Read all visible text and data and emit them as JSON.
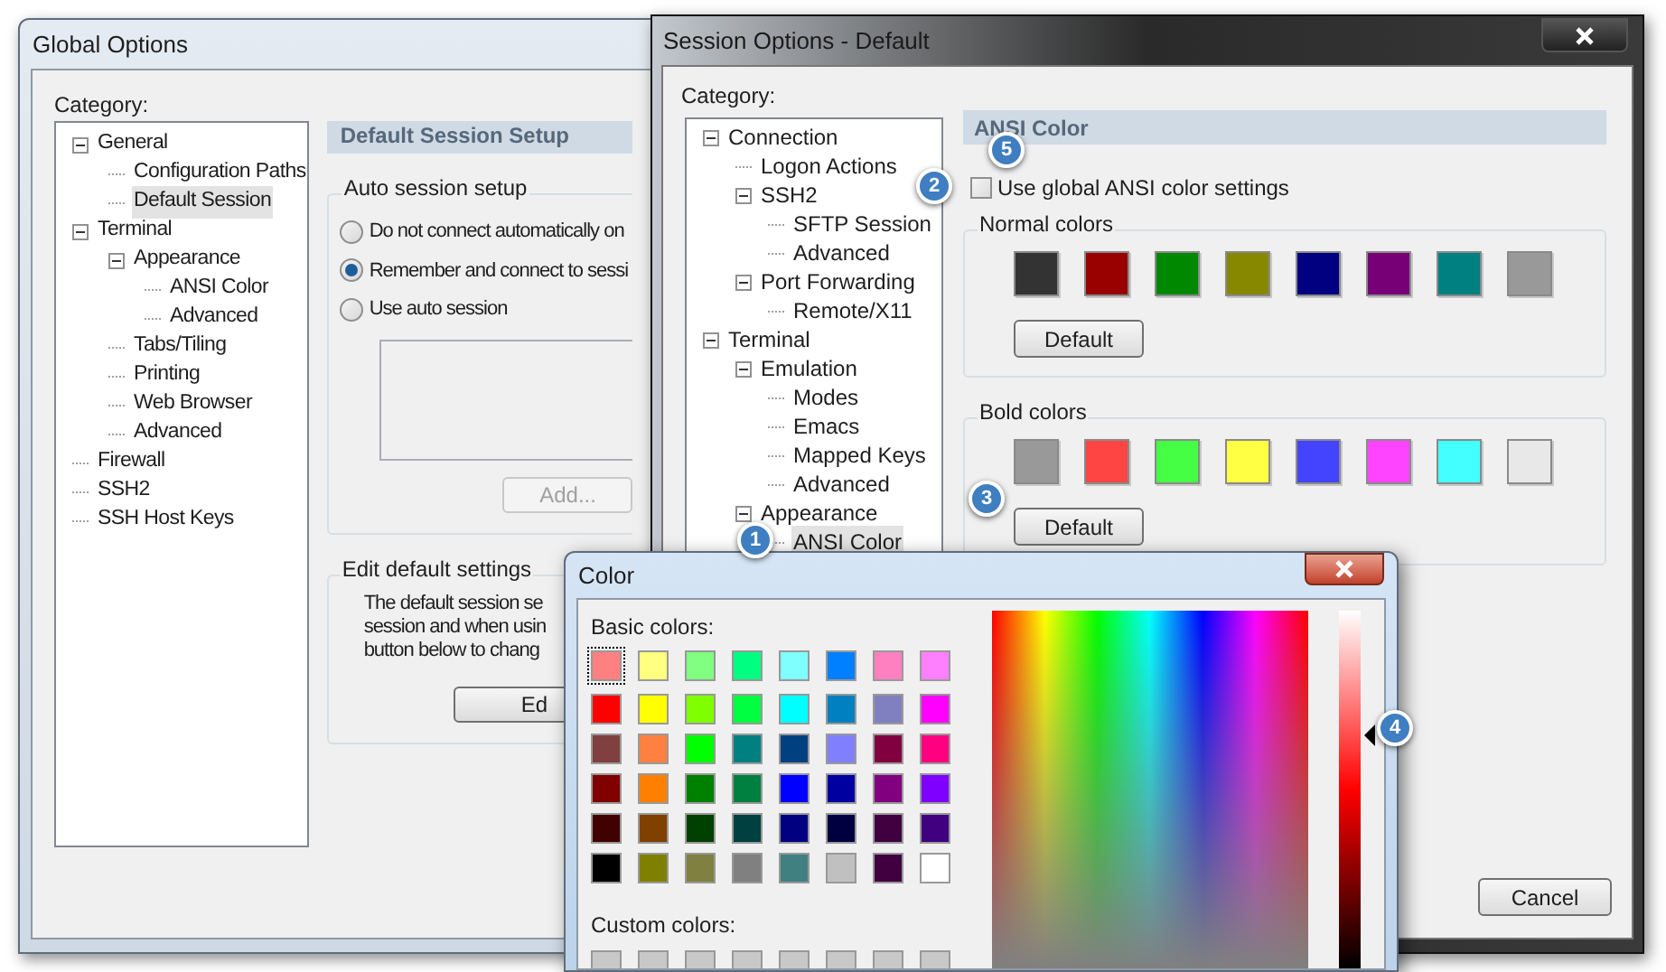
{
  "global_options": {
    "title": "Global Options",
    "category_label": "Category:",
    "tree": [
      {
        "label": "General",
        "expanded": true,
        "selected": false,
        "children": [
          {
            "label": "Configuration Paths",
            "selected": false
          },
          {
            "label": "Default Session",
            "selected": true
          }
        ]
      },
      {
        "label": "Terminal",
        "expanded": true,
        "selected": false,
        "children": [
          {
            "label": "Appearance",
            "expanded": true,
            "selected": false,
            "children": [
              {
                "label": "ANSI Color",
                "selected": false
              },
              {
                "label": "Advanced",
                "selected": false
              }
            ]
          },
          {
            "label": "Tabs/Tiling",
            "selected": false
          },
          {
            "label": "Printing",
            "selected": false
          },
          {
            "label": "Web Browser",
            "selected": false
          },
          {
            "label": "Advanced",
            "selected": false
          }
        ]
      },
      {
        "label": "Firewall",
        "selected": false
      },
      {
        "label": "SSH2",
        "selected": false
      },
      {
        "label": "SSH Host Keys",
        "selected": false
      }
    ],
    "panel_title": "Default Session Setup",
    "auto_session": {
      "label": "Auto session setup",
      "options": [
        {
          "label": "Do not connect automatically on",
          "selected": false
        },
        {
          "label": "Remember and connect to sessi",
          "selected": true
        },
        {
          "label": "Use auto session",
          "selected": false
        }
      ],
      "add_button": {
        "label": "Add...",
        "disabled": true
      }
    },
    "edit_defaults": {
      "label": "Edit default settings",
      "lines": [
        "The default session se",
        "session and when usin",
        "button below to chang"
      ],
      "button": "Ed"
    }
  },
  "session_options": {
    "title": "Session Options - Default",
    "category_label": "Category:",
    "tree": [
      {
        "label": "Connection",
        "expanded": true,
        "selected": false,
        "children": [
          {
            "label": "Logon Actions",
            "selected": false
          },
          {
            "label": "SSH2",
            "expanded": true,
            "selected": false,
            "children": [
              {
                "label": "SFTP Session",
                "selected": false
              },
              {
                "label": "Advanced",
                "selected": false
              }
            ]
          },
          {
            "label": "Port Forwarding",
            "expanded": true,
            "selected": false,
            "children": [
              {
                "label": "Remote/X11",
                "selected": false
              }
            ]
          }
        ]
      },
      {
        "label": "Terminal",
        "expanded": true,
        "selected": false,
        "children": [
          {
            "label": "Emulation",
            "expanded": true,
            "selected": false,
            "children": [
              {
                "label": "Modes",
                "selected": false
              },
              {
                "label": "Emacs",
                "selected": false
              },
              {
                "label": "Mapped Keys",
                "selected": false
              },
              {
                "label": "Advanced",
                "selected": false
              }
            ]
          },
          {
            "label": "Appearance",
            "expanded": true,
            "selected": false,
            "children": [
              {
                "label": "ANSI Color",
                "selected": true
              }
            ]
          }
        ]
      }
    ],
    "panel_title": "ANSI Color",
    "use_global": {
      "label": "Use global ANSI color settings",
      "checked": false
    },
    "normal_colors": {
      "label": "Normal colors",
      "swatches": [
        {
          "color": "#333333"
        },
        {
          "color": "#990000"
        },
        {
          "color": "#008800"
        },
        {
          "color": "#888800"
        },
        {
          "color": "#000080"
        },
        {
          "color": "#770077"
        },
        {
          "color": "#008080"
        },
        {
          "color": "#999999"
        }
      ],
      "button": "Default"
    },
    "bold_colors": {
      "label": "Bold colors",
      "swatches": [
        {
          "color": "#999999"
        },
        {
          "color": "#ff4444"
        },
        {
          "color": "#44ff44"
        },
        {
          "color": "#ffff44"
        },
        {
          "color": "#4444ff"
        },
        {
          "color": "#ff44ff"
        },
        {
          "color": "#44ffff"
        },
        {
          "color": "#e8e8e8"
        }
      ],
      "button": "Default"
    },
    "cancel_button": "Cancel"
  },
  "color_dialog": {
    "title": "Color",
    "basic_label": "Basic colors:",
    "basic_colors": [
      {
        "color": "#ff8080",
        "selected": true
      },
      {
        "color": "#ffff80",
        "selected": false
      },
      {
        "color": "#80ff80",
        "selected": false
      },
      {
        "color": "#00ff80",
        "selected": false
      },
      {
        "color": "#80ffff",
        "selected": false
      },
      {
        "color": "#0080ff",
        "selected": false
      },
      {
        "color": "#ff80c0",
        "selected": false
      },
      {
        "color": "#ff80ff",
        "selected": false
      },
      {
        "color": "#ff0000",
        "selected": false
      },
      {
        "color": "#ffff00",
        "selected": false
      },
      {
        "color": "#80ff00",
        "selected": false
      },
      {
        "color": "#00ff40",
        "selected": false
      },
      {
        "color": "#00ffff",
        "selected": false
      },
      {
        "color": "#0080c0",
        "selected": false
      },
      {
        "color": "#8080c0",
        "selected": false
      },
      {
        "color": "#ff00ff",
        "selected": false
      },
      {
        "color": "#804040",
        "selected": false
      },
      {
        "color": "#ff8040",
        "selected": false
      },
      {
        "color": "#00ff00",
        "selected": false
      },
      {
        "color": "#008080",
        "selected": false
      },
      {
        "color": "#004080",
        "selected": false
      },
      {
        "color": "#8080ff",
        "selected": false
      },
      {
        "color": "#800040",
        "selected": false
      },
      {
        "color": "#ff0080",
        "selected": false
      },
      {
        "color": "#800000",
        "selected": false
      },
      {
        "color": "#ff8000",
        "selected": false
      },
      {
        "color": "#008000",
        "selected": false
      },
      {
        "color": "#008040",
        "selected": false
      },
      {
        "color": "#0000ff",
        "selected": false
      },
      {
        "color": "#0000a0",
        "selected": false
      },
      {
        "color": "#800080",
        "selected": false
      },
      {
        "color": "#8000ff",
        "selected": false
      },
      {
        "color": "#400000",
        "selected": false
      },
      {
        "color": "#804000",
        "selected": false
      },
      {
        "color": "#004000",
        "selected": false
      },
      {
        "color": "#004040",
        "selected": false
      },
      {
        "color": "#000080",
        "selected": false
      },
      {
        "color": "#000040",
        "selected": false
      },
      {
        "color": "#400040",
        "selected": false
      },
      {
        "color": "#400080",
        "selected": false
      },
      {
        "color": "#000000",
        "selected": false
      },
      {
        "color": "#808000",
        "selected": false
      },
      {
        "color": "#808040",
        "selected": false
      },
      {
        "color": "#808080",
        "selected": false
      },
      {
        "color": "#408080",
        "selected": false
      },
      {
        "color": "#c0c0c0",
        "selected": false
      },
      {
        "color": "#400040",
        "selected": false
      },
      {
        "color": "#ffffff",
        "selected": false
      }
    ],
    "custom_label": "Custom colors:",
    "custom_colors": [
      {
        "color": "#c8c8c8"
      },
      {
        "color": "#c8c8c8"
      },
      {
        "color": "#c8c8c8"
      },
      {
        "color": "#c8c8c8"
      },
      {
        "color": "#c8c8c8"
      },
      {
        "color": "#c8c8c8"
      },
      {
        "color": "#c8c8c8"
      },
      {
        "color": "#c8c8c8"
      }
    ],
    "luminance": {
      "level": 0.65
    }
  },
  "callouts": [
    "1",
    "2",
    "3",
    "4",
    "5"
  ]
}
